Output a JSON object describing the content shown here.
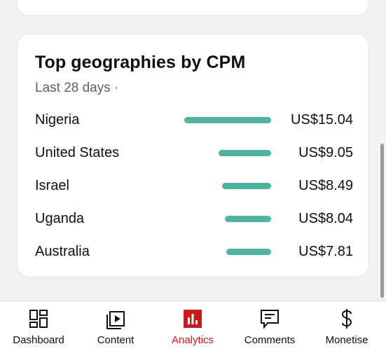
{
  "card": {
    "title": "Top geographies by CPM",
    "subtitle": "Last 28 days ·",
    "rows": [
      {
        "country": "Nigeria",
        "value": "US$15.04",
        "cpm": 15.04
      },
      {
        "country": "United States",
        "value": "US$9.05",
        "cpm": 9.05
      },
      {
        "country": "Israel",
        "value": "US$8.49",
        "cpm": 8.49
      },
      {
        "country": "Uganda",
        "value": "US$8.04",
        "cpm": 8.04
      },
      {
        "country": "Australia",
        "value": "US$7.81",
        "cpm": 7.81
      }
    ],
    "bar_color": "#4fb3a0"
  },
  "nav": {
    "active_color": "#cc1a1a",
    "items": [
      {
        "label": "Dashboard",
        "icon": "dashboard-icon"
      },
      {
        "label": "Content",
        "icon": "content-icon"
      },
      {
        "label": "Analytics",
        "icon": "analytics-icon",
        "active": true
      },
      {
        "label": "Comments",
        "icon": "comments-icon"
      },
      {
        "label": "Monetise",
        "icon": "monetise-icon"
      }
    ]
  }
}
